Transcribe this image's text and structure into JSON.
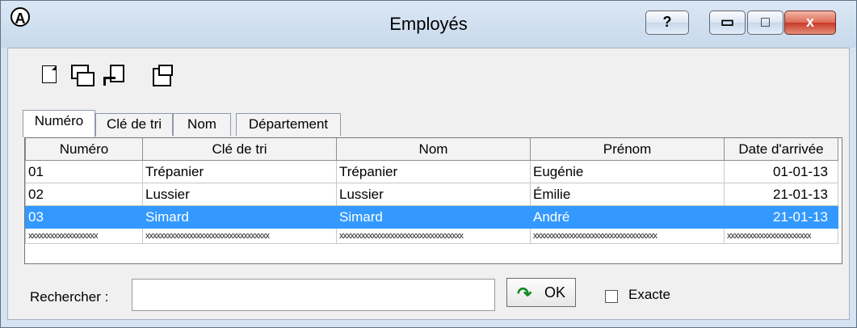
{
  "window": {
    "title": "Employés",
    "app_icon": "A",
    "buttons": {
      "help": "?",
      "minimize": "▭",
      "maximize": "□",
      "close": "x"
    }
  },
  "toolbar": [
    {
      "icon": "new-document-icon"
    },
    {
      "icon": "copy-icon"
    },
    {
      "icon": "export-icon"
    },
    {
      "icon": "properties-icon"
    }
  ],
  "tabs": [
    "Numéro",
    "Clé de tri",
    "Nom",
    "Département"
  ],
  "active_tab": "Numéro",
  "table": {
    "headers": [
      "Numéro",
      "Clé de tri",
      "Nom",
      "Prénom",
      "Date d'arrivée"
    ],
    "rows": [
      [
        "01",
        "Trépanier",
        "Trépanier",
        "Eugénie",
        "01-01-13"
      ],
      [
        "02",
        "Lussier",
        "Lussier",
        "Émilie",
        "21-01-13"
      ],
      [
        "03",
        "Simard",
        "Simard",
        "André",
        "21-01-13"
      ],
      [
        "xxxxxxxxxxxxxxxxxxx",
        "xxxxxxxxxxxxxxxxxxxxxxxxxxxxxxxxxx",
        "xxxxxxxxxxxxxxxxxxxxxxxxxxxxxxxxxx",
        "xxxxxxxxxxxxxxxxxxxxxxxxxxxxxxxxxx",
        "xxxxxxxxxxxxxxxxxxxxxxx"
      ]
    ],
    "selected_row": 2
  },
  "search": {
    "label": "Rechercher :",
    "value": "",
    "ok_label": "OK",
    "exact_label": "Exacte",
    "exact_checked": false
  },
  "colors": {
    "selection": "#3399ff",
    "title_bg": "#d6e3f0"
  }
}
